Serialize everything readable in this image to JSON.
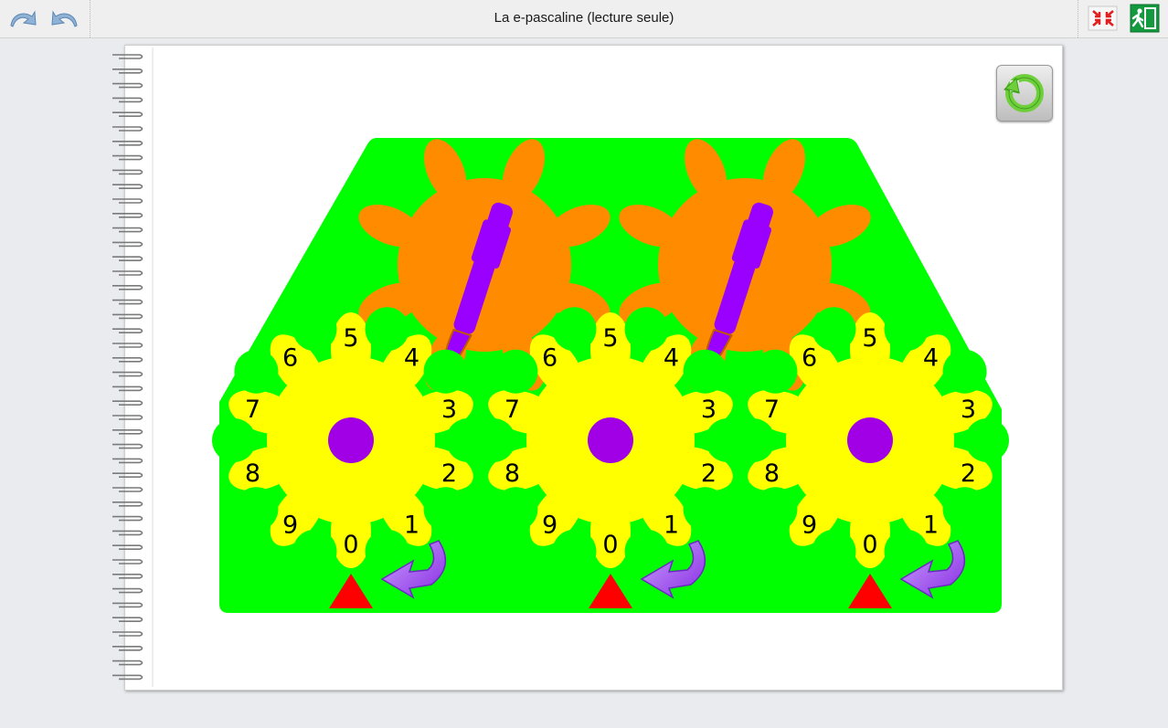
{
  "window": {
    "title": "La e-pascaline (lecture seule)"
  },
  "toolbar": {
    "undo_icon": "undo-arrow-icon",
    "redo_icon": "redo-arrow-icon",
    "fullscreen_icon": "collapse-arrows-icon",
    "exit_icon": "emergency-exit-icon"
  },
  "pascaline": {
    "reset_icon": "circular-arrow-icon",
    "wheels": [
      {
        "name": "wheel-1",
        "digits": [
          "0",
          "1",
          "2",
          "3",
          "4",
          "5",
          "6",
          "7",
          "8",
          "9"
        ]
      },
      {
        "name": "wheel-2",
        "digits": [
          "0",
          "1",
          "2",
          "3",
          "4",
          "5",
          "6",
          "7",
          "8",
          "9"
        ]
      },
      {
        "name": "wheel-3",
        "digits": [
          "0",
          "1",
          "2",
          "3",
          "4",
          "5",
          "6",
          "7",
          "8",
          "9"
        ]
      }
    ],
    "colors": {
      "frame": "#00ff00",
      "wheel": "#ffff00",
      "hub": "#a100e6",
      "carry_gear": "#ff8c00",
      "lever": "#9900ff",
      "marker": "#ff0000",
      "turn_arrow": "#9b4ae0"
    }
  }
}
